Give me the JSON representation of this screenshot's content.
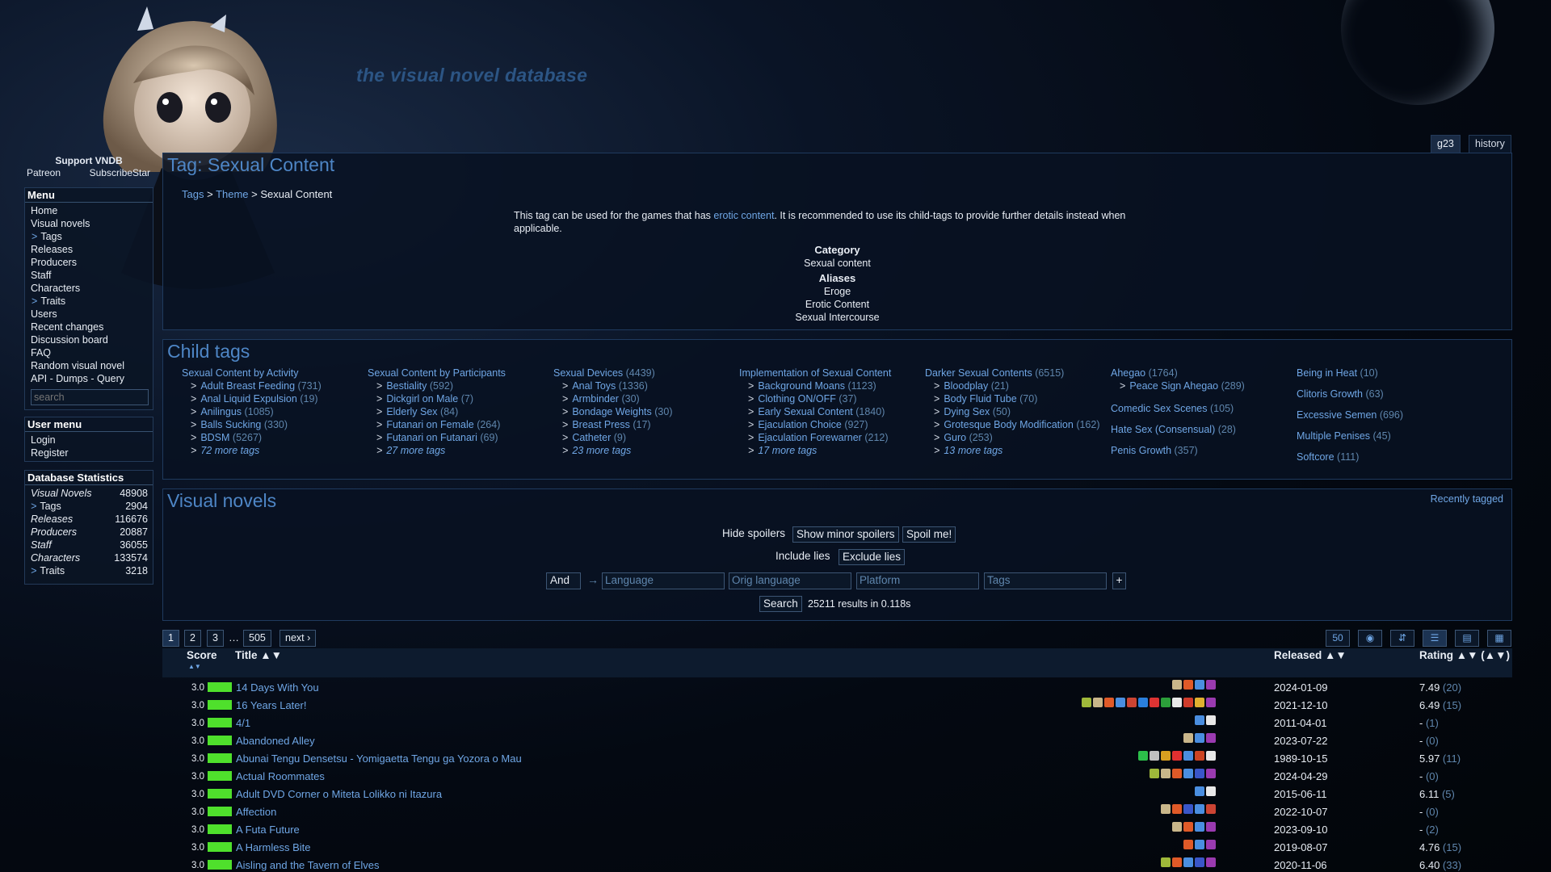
{
  "site_title": "the visual novel database",
  "support": {
    "title": "Support VNDB",
    "patreon": "Patreon",
    "subscribestar": "SubscribeStar"
  },
  "menu": {
    "title": "Menu",
    "items": [
      "Home",
      "Visual novels",
      "Tags",
      "Releases",
      "Producers",
      "Staff",
      "Characters",
      "Traits",
      "Users",
      "Recent changes",
      "Discussion board",
      "FAQ",
      "Random visual novel",
      "API - Dumps - Query"
    ],
    "search_placeholder": "search"
  },
  "user_menu": {
    "title": "User menu",
    "items": [
      "Login",
      "Register"
    ]
  },
  "db_stats": {
    "title": "Database Statistics",
    "rows": [
      [
        "Visual Novels",
        "48908"
      ],
      [
        "Tags",
        "2904"
      ],
      [
        "Releases",
        "116676"
      ],
      [
        "Producers",
        "20887"
      ],
      [
        "Staff",
        "36055"
      ],
      [
        "Characters",
        "133574"
      ],
      [
        "Traits",
        "3218"
      ]
    ]
  },
  "tabs": {
    "id": "g23",
    "history": "history"
  },
  "tag": {
    "heading": "Tag: Sexual Content",
    "breadcrumb": {
      "tags": "Tags",
      "sep": ">",
      "theme": "Theme",
      "current": "Sexual Content"
    },
    "desc_pre": "This tag can be used for the games that has ",
    "desc_link": "erotic content",
    "desc_post": ". It is recommended to use its child-tags to provide further details instead when applicable.",
    "category_label": "Category",
    "category": "Sexual content",
    "aliases_label": "Aliases",
    "aliases": [
      "Eroge",
      "Erotic Content",
      "Sexual Intercourse"
    ]
  },
  "child_tags": {
    "heading": "Child tags",
    "columns": [
      {
        "name": "Sexual Content by Activity",
        "count": "",
        "items": [
          [
            "Adult Breast Feeding",
            "(731)"
          ],
          [
            "Anal Liquid Expulsion",
            "(19)"
          ],
          [
            "Anilingus",
            "(1085)"
          ],
          [
            "Balls Sucking",
            "(330)"
          ],
          [
            "BDSM",
            "(5267)"
          ]
        ],
        "more": "72 more tags"
      },
      {
        "name": "Sexual Content by Participants",
        "count": "",
        "items": [
          [
            "Bestiality",
            "(592)"
          ],
          [
            "Dickgirl on Male",
            "(7)"
          ],
          [
            "Elderly Sex",
            "(84)"
          ],
          [
            "Futanari on Female",
            "(264)"
          ],
          [
            "Futanari on Futanari",
            "(69)"
          ]
        ],
        "more": "27 more tags"
      },
      {
        "name": "Sexual Devices",
        "count": "(4439)",
        "items": [
          [
            "Anal Toys",
            "(1336)"
          ],
          [
            "Armbinder",
            "(30)"
          ],
          [
            "Bondage Weights",
            "(30)"
          ],
          [
            "Breast Press",
            "(17)"
          ],
          [
            "Catheter",
            "(9)"
          ]
        ],
        "more": "23 more tags"
      },
      {
        "name": "Implementation of Sexual Content",
        "count": "",
        "items": [
          [
            "Background Moans",
            "(1123)"
          ],
          [
            "Clothing ON/OFF",
            "(37)"
          ],
          [
            "Early Sexual Content",
            "(1840)"
          ],
          [
            "Ejaculation Choice",
            "(927)"
          ],
          [
            "Ejaculation Forewarner",
            "(212)"
          ]
        ],
        "more": "17 more tags"
      },
      {
        "name": "Darker Sexual Contents",
        "count": "(6515)",
        "items": [
          [
            "Bloodplay",
            "(21)"
          ],
          [
            "Body Fluid Tube",
            "(70)"
          ],
          [
            "Dying Sex",
            "(50)"
          ],
          [
            "Grotesque Body Modification",
            "(162)"
          ],
          [
            "Guro",
            "(253)"
          ]
        ],
        "more": "13 more tags"
      }
    ],
    "col6": {
      "first": [
        "Ahegao",
        "(1764)"
      ],
      "first_child": [
        "Peace Sign Ahegao",
        "(289)"
      ],
      "items": [
        [
          "Comedic Sex Scenes",
          "(105)"
        ],
        [
          "Hate Sex (Consensual)",
          "(28)"
        ],
        [
          "Penis Growth",
          "(357)"
        ]
      ]
    },
    "col7": {
      "items": [
        [
          "Being in Heat",
          "(10)"
        ],
        [
          "Clitoris Growth",
          "(63)"
        ],
        [
          "Excessive Semen",
          "(696)"
        ],
        [
          "Multiple Penises",
          "(45)"
        ],
        [
          "Softcore",
          "(111)"
        ]
      ]
    }
  },
  "vn": {
    "heading": "Visual novels",
    "recently_tagged": "Recently tagged",
    "hide_spoilers": "Hide spoilers",
    "show_minor": "Show minor spoilers",
    "spoil_me": "Spoil me!",
    "include_lies": "Include lies",
    "exclude_lies": "Exclude lies",
    "and": "And",
    "arrow": "→",
    "language": "Language",
    "orig_language": "Orig language",
    "platform": "Platform",
    "tags": "Tags",
    "plus": "+",
    "search": "Search",
    "results": "25211 results in 0.118s",
    "pages": [
      "1",
      "2",
      "3",
      "…",
      "505",
      "next ›"
    ],
    "per_page": "50",
    "cols": {
      "score": "Score",
      "title": "Title ▲▼",
      "released": "Released ▲▼",
      "rating": "Rating ▲▼ (▲▼)",
      "score_sort": "▲▼"
    },
    "rows": [
      {
        "score": "3.0",
        "title": "14 Days With You",
        "released": "2024-01-09",
        "rating": "7.49",
        "votes": "(20)",
        "icons": [
          "#c9b68a",
          "#e05a28",
          "#4a8ee0",
          "#9a3ab0"
        ]
      },
      {
        "score": "3.0",
        "title": "16 Years Later!",
        "released": "2021-12-10",
        "rating": "6.49",
        "votes": "(15)",
        "icons": [
          "#9fb83a",
          "#c9b68a",
          "#e05a28",
          "#4a8ee0",
          "#c43",
          "#2a7fdc",
          "#d33",
          "#2c9e3a",
          "#e8e8e8",
          "#cf3b2b",
          "#e0b030",
          "#9a3ab0"
        ]
      },
      {
        "score": "3.0",
        "title": "4/1",
        "released": "2011-04-01",
        "rating": "-",
        "votes": "(1)",
        "icons": [
          "#4a8ee0",
          "#e8e8e8"
        ]
      },
      {
        "score": "3.0",
        "title": "Abandoned Alley",
        "released": "2023-07-22",
        "rating": "-",
        "votes": "(0)",
        "icons": [
          "#c9b68a",
          "#4a8ee0",
          "#9a3ab0"
        ]
      },
      {
        "score": "3.0",
        "title": "Abunai Tengu Densetsu - Yomigaetta Tengu ga Yozora o Mau",
        "released": "1989-10-15",
        "rating": "5.97",
        "votes": "(11)",
        "icons": [
          "#2cbf4a",
          "#c0c0c0",
          "#d9a020",
          "#e03030",
          "#4a8ee0",
          "#c42",
          "#e8e8e8"
        ]
      },
      {
        "score": "3.0",
        "title": "Actual Roommates",
        "released": "2024-04-29",
        "rating": "-",
        "votes": "(0)",
        "icons": [
          "#9fb83a",
          "#c9b68a",
          "#e05a28",
          "#4a8ee0",
          "#3a56c8",
          "#9a3ab0"
        ]
      },
      {
        "score": "3.0",
        "title": "Adult DVD Corner o Miteta Lolikko ni Itazura",
        "released": "2015-06-11",
        "rating": "6.11",
        "votes": "(5)",
        "icons": [
          "#4a8ee0",
          "#e8e8e8"
        ]
      },
      {
        "score": "3.0",
        "title": "Affection",
        "released": "2022-10-07",
        "rating": "-",
        "votes": "(0)",
        "icons": [
          "#c9b68a",
          "#e05a28",
          "#3a56c8",
          "#4a8ee0",
          "#c43"
        ]
      },
      {
        "score": "3.0",
        "title": "A Futa Future",
        "released": "2023-09-10",
        "rating": "-",
        "votes": "(2)",
        "icons": [
          "#c9b68a",
          "#e05a28",
          "#4a8ee0",
          "#9a3ab0"
        ]
      },
      {
        "score": "3.0",
        "title": "A Harmless Bite",
        "released": "2019-08-07",
        "rating": "4.76",
        "votes": "(15)",
        "icons": [
          "#e05a28",
          "#4a8ee0",
          "#9a3ab0"
        ]
      },
      {
        "score": "3.0",
        "title": "Aisling and the Tavern of Elves",
        "released": "2020-11-06",
        "rating": "6.40",
        "votes": "(33)",
        "icons": [
          "#9fb83a",
          "#e05a28",
          "#4a8ee0",
          "#3a56c8",
          "#9a3ab0"
        ]
      }
    ]
  },
  "colors": {
    "accent": "#6fa6e5",
    "heading": "#4e86c6",
    "score_bar": "#4fe02c",
    "background": "#050b16"
  }
}
